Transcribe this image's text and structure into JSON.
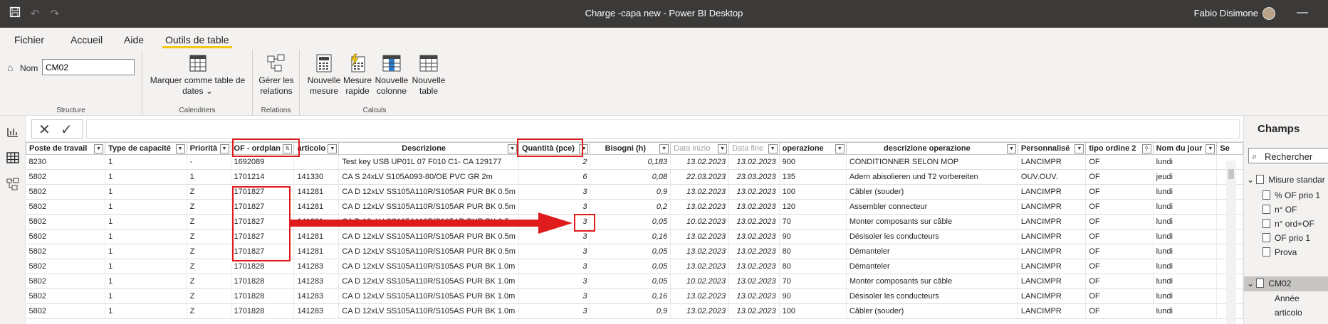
{
  "titlebar": {
    "title": "Charge -capa new - Power BI Desktop",
    "user": "Fabio Disimone",
    "save_icon": "save-icon",
    "undo_icon": "undo-icon",
    "redo_icon": "redo-icon"
  },
  "menu": {
    "items": [
      "Fichier",
      "Accueil",
      "Aide",
      "Outils de table"
    ],
    "active": "Outils de table"
  },
  "ribbon": {
    "name_label": "Nom",
    "name_value": "CM02",
    "structure_label": "Structure",
    "mark_line1": "Marquer comme table de",
    "mark_line2": "dates",
    "calendars_label": "Calendriers",
    "rel_line1": "Gérer les",
    "rel_line2": "relations",
    "relations_label": "Relations",
    "new_measure_line1": "Nouvelle",
    "new_measure_line2": "mesure",
    "quick_measure_line1": "Mesure",
    "quick_measure_line2": "rapide",
    "new_column_line1": "Nouvelle",
    "new_column_line2": "colonne",
    "new_table_line1": "Nouvelle",
    "new_table_line2": "table",
    "calculs_label": "Calculs"
  },
  "table": {
    "columns": [
      "Poste de travail",
      "Type de capacité",
      "Priorità",
      "OF - ordplan",
      "articolo",
      "Descrizione",
      "Quantità (pce)",
      "Bisogni (h)",
      "Data inizio",
      "Data fine",
      "operazione",
      "descrizione operazione",
      "Personnalisé",
      "tipo ordine 2",
      "Nom du jour",
      "Se"
    ],
    "rows": [
      [
        "8230",
        "1",
        "-",
        "1692089",
        "",
        "Test key USB UP01L 07 F010 C1- CA 129177",
        "2",
        "0,183",
        "13.02.2023",
        "13.02.2023",
        "900",
        "CONDITIONNER SELON MOP",
        "LANCIMPR",
        "OF",
        "lundi"
      ],
      [
        "5802",
        "1",
        "1",
        "1701214",
        "141330",
        "CA S 24xLV S105A093-80/OE PVC GR 2m",
        "6",
        "0,08",
        "22.03.2023",
        "23.03.2023",
        "135",
        "Adern abisolieren und T2 vorbereiten",
        "OUV.OUV.",
        "OF",
        "jeudi"
      ],
      [
        "5802",
        "1",
        "Z",
        "1701827",
        "141281",
        "CA D 12xLV SS105A110R/S105AR PUR BK 0.5m",
        "3",
        "0,9",
        "13.02.2023",
        "13.02.2023",
        "100",
        "Câbler (souder)",
        "LANCIMPR",
        "OF",
        "lundi"
      ],
      [
        "5802",
        "1",
        "Z",
        "1701827",
        "141281",
        "CA D 12xLV SS105A110R/S105AR PUR BK 0.5m",
        "3",
        "0,2",
        "13.02.2023",
        "13.02.2023",
        "120",
        "Assembler connecteur",
        "LANCIMPR",
        "OF",
        "lundi"
      ],
      [
        "5802",
        "1",
        "Z",
        "1701827",
        "141281",
        "CA D 12xLV SS105A110R/S105AR PUR BK 0.5m",
        "3",
        "0,05",
        "10.02.2023",
        "13.02.2023",
        "70",
        "Monter composants sur câble",
        "LANCIMPR",
        "OF",
        "lundi"
      ],
      [
        "5802",
        "1",
        "Z",
        "1701827",
        "141281",
        "CA D 12xLV SS105A110R/S105AR PUR BK 0.5m",
        "3",
        "0,16",
        "13.02.2023",
        "13.02.2023",
        "90",
        "Désisoler les conducteurs",
        "LANCIMPR",
        "OF",
        "lundi"
      ],
      [
        "5802",
        "1",
        "Z",
        "1701827",
        "141281",
        "CA D 12xLV SS105A110R/S105AR PUR BK 0.5m",
        "3",
        "0,05",
        "13.02.2023",
        "13.02.2023",
        "80",
        "Démanteler",
        "LANCIMPR",
        "OF",
        "lundi"
      ],
      [
        "5802",
        "1",
        "Z",
        "1701828",
        "141283",
        "CA D 12xLV SS105A110R/S105AS PUR BK 1.0m",
        "3",
        "0,05",
        "13.02.2023",
        "13.02.2023",
        "80",
        "Démanteler",
        "LANCIMPR",
        "OF",
        "lundi"
      ],
      [
        "5802",
        "1",
        "Z",
        "1701828",
        "141283",
        "CA D 12xLV SS105A110R/S105AS PUR BK 1.0m",
        "3",
        "0,05",
        "10.02.2023",
        "13.02.2023",
        "70",
        "Monter composants sur câble",
        "LANCIMPR",
        "OF",
        "lundi"
      ],
      [
        "5802",
        "1",
        "Z",
        "1701828",
        "141283",
        "CA D 12xLV SS105A110R/S105AS PUR BK 1.0m",
        "3",
        "0,16",
        "13.02.2023",
        "13.02.2023",
        "90",
        "Désisoler les conducteurs",
        "LANCIMPR",
        "OF",
        "lundi"
      ],
      [
        "5802",
        "1",
        "Z",
        "1701828",
        "141283",
        "CA D 12xLV SS105A110R/S105AS PUR BK 1.0m",
        "3",
        "0,9",
        "13.02.2023",
        "13.02.2023",
        "100",
        "Câbler (souder)",
        "LANCIMPR",
        "OF",
        "lundi"
      ]
    ]
  },
  "fields_pane": {
    "title": "Champs",
    "search_placeholder": "Rechercher",
    "group1": "Misure standar",
    "group1_items": [
      "% OF prio 1",
      "n° OF",
      "n° ord+OF",
      "OF prio 1",
      "Prova"
    ],
    "group2": "CM02",
    "group2_items": [
      "Année",
      "articolo"
    ]
  },
  "colors": {
    "highlight": "#e01b1b",
    "accent": "#f2c811",
    "titlebar": "#3b3a39"
  }
}
